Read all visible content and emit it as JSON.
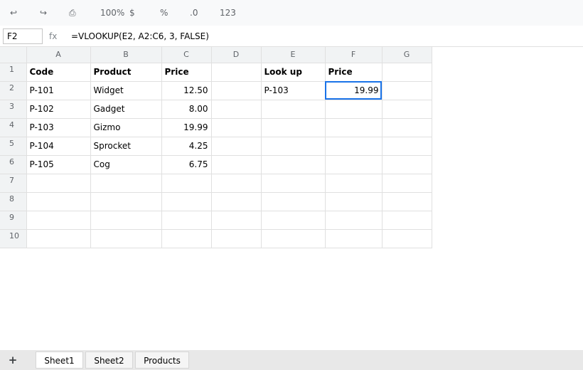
{
  "toolbar": {
    "undo_icon": "↩",
    "redo_icon": "↪",
    "print_icon": "⎙",
    "zoom": "100%",
    "currency": "$",
    "percent": "%",
    "decimal": ".0",
    "number_format": "123"
  },
  "formula_bar": {
    "cell_ref": "F2",
    "fx_label": "fx",
    "formula": "=VLOOKUP(E2, A2:C6, 3, FALSE)"
  },
  "grid": {
    "columns": [
      "A",
      "B",
      "C",
      "D",
      "E",
      "F",
      "G"
    ],
    "rows": [
      {
        "n": "1",
        "cells": [
          "Code",
          "Product",
          "Price",
          "",
          "Look up",
          "Price",
          ""
        ]
      },
      {
        "n": "2",
        "cells": [
          "P-101",
          "Widget",
          "12.50",
          "",
          "P-103",
          "19.99",
          ""
        ]
      },
      {
        "n": "3",
        "cells": [
          "P-102",
          "Gadget",
          "8.00",
          "",
          "",
          "",
          ""
        ]
      },
      {
        "n": "4",
        "cells": [
          "P-103",
          "Gizmo",
          "19.99",
          "",
          "",
          "",
          ""
        ]
      },
      {
        "n": "5",
        "cells": [
          "P-104",
          "Sprocket",
          "4.25",
          "",
          "",
          "",
          ""
        ]
      },
      {
        "n": "6",
        "cells": [
          "P-105",
          "Cog",
          "6.75",
          "",
          "",
          "",
          ""
        ]
      },
      {
        "n": "7",
        "cells": [
          "",
          "",
          "",
          "",
          "",
          "",
          ""
        ]
      },
      {
        "n": "8",
        "cells": [
          "",
          "",
          "",
          "",
          "",
          "",
          ""
        ]
      },
      {
        "n": "9",
        "cells": [
          "",
          "",
          "",
          "",
          "",
          "",
          ""
        ]
      },
      {
        "n": "10",
        "cells": [
          "",
          "",
          "",
          "",
          "",
          "",
          ""
        ]
      }
    ],
    "selected_cell": "F2"
  },
  "sheet_tabs": {
    "add_icon": "+",
    "tabs": [
      "Sheet1",
      "Sheet2",
      "Products"
    ],
    "active": "Sheet1"
  },
  "colors": {
    "selection": "#1a73e8",
    "header_bg": "#f1f3f4",
    "gridline": "#e0e0e0"
  }
}
